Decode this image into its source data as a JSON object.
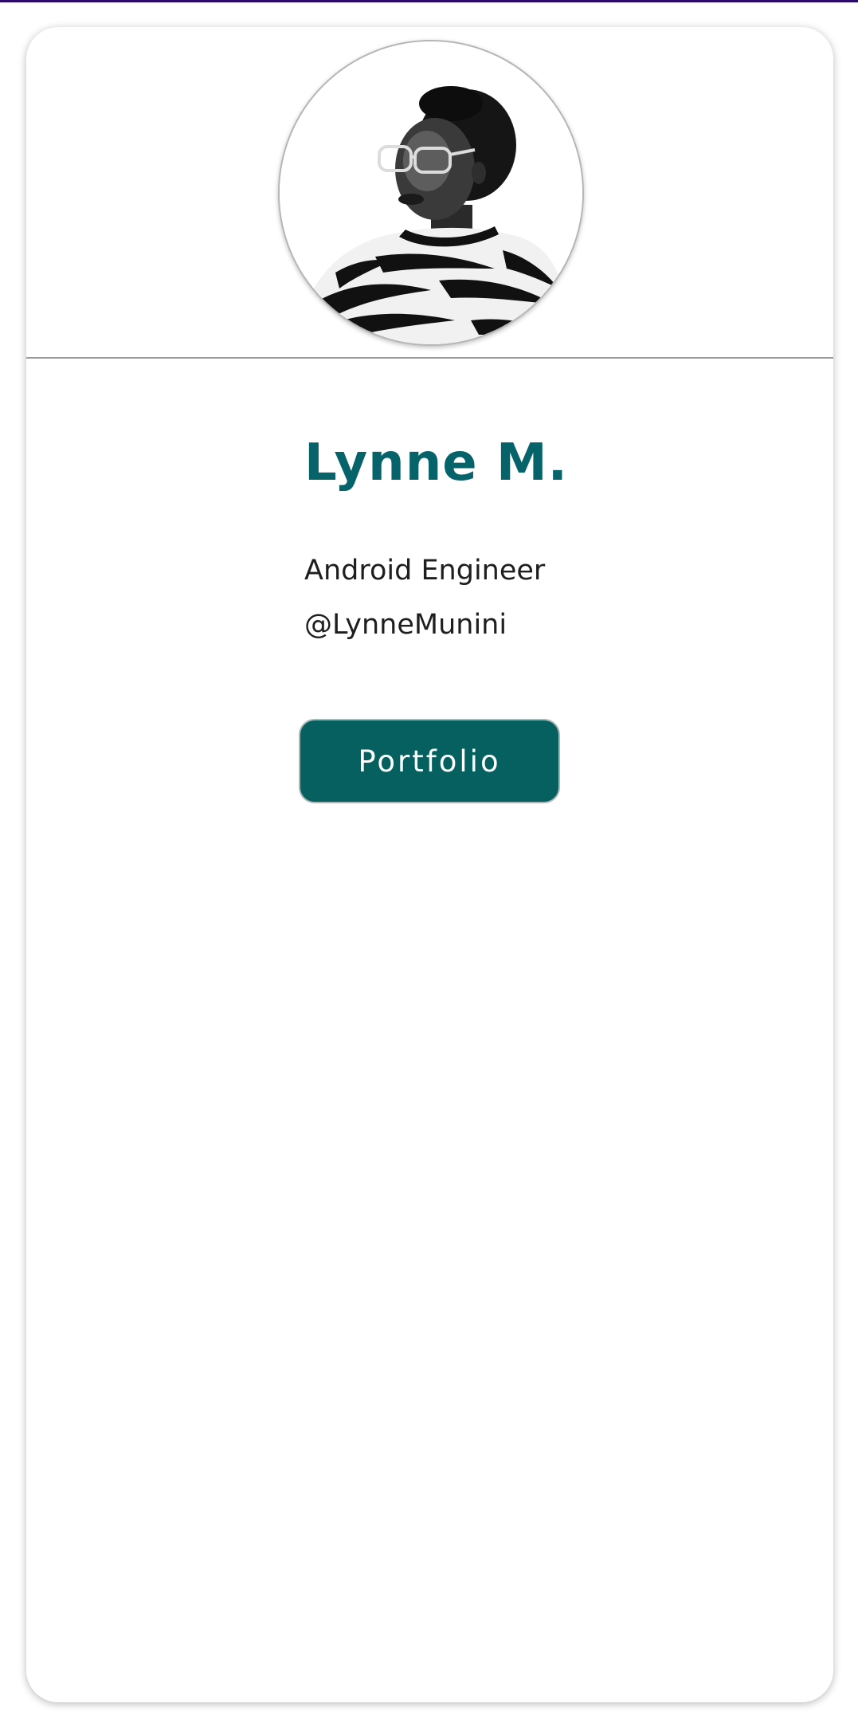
{
  "theme": {
    "accent": "#07636a",
    "button_background": "#05605f",
    "button_text": "#ffffff",
    "top_strip": "#2b0a6b",
    "text": "#1e1e1e"
  },
  "profile": {
    "avatar_icon": "profile-photo",
    "name": "Lynne M.",
    "role": "Android Engineer",
    "handle": "@LynneMunini"
  },
  "actions": {
    "portfolio_label": "Portfolio"
  }
}
